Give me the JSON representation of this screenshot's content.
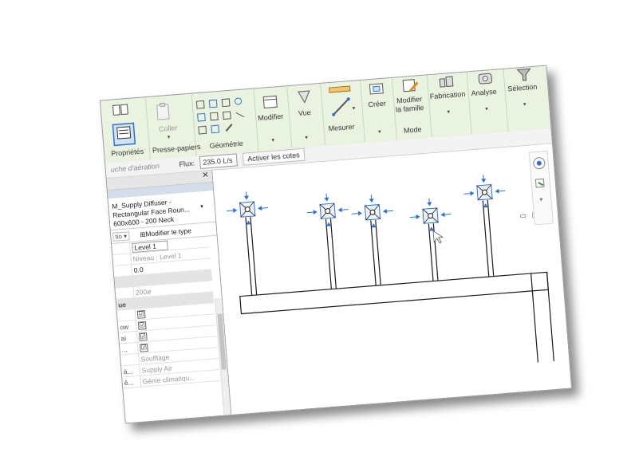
{
  "ribbon": {
    "proprietes_label": "Propriétés",
    "coller_label": "Coller",
    "presse_papiers_label": "Presse-papiers",
    "geometrie_label": "Géométrie",
    "modifier_label": "Modifier",
    "vue_label": "Vue",
    "mesurer_label": "Mesurer",
    "creer_label": "Créer",
    "modifier_famille_line1": "Modifier",
    "modifier_famille_line2": "la famille",
    "mode_label": "Mode",
    "fabrication_label": "Fabrication",
    "analyse_label": "Analyse",
    "selection_label": "Sélection"
  },
  "options_bar": {
    "context_label": "uche d'aération",
    "flux_label": "Flux:",
    "flux_value": "235.0 L/s",
    "activer_cotes_label": "Activer les cotes"
  },
  "properties": {
    "type_line1": "M_Supply Diffuser -",
    "type_line2": "Rectangular Face Roun...",
    "type_line3": "600x600 - 200 Neck",
    "filter_label": "tio",
    "edit_type_label": "Modifier le type",
    "rows": [
      {
        "key": "",
        "value": "Level 1",
        "style": "input"
      },
      {
        "key": "",
        "value": "Niveau : Level 1",
        "style": "gray"
      },
      {
        "key": "",
        "value": "0.0",
        "style": "plain"
      },
      {
        "key": "",
        "value": "",
        "style": "hdr"
      },
      {
        "key": "",
        "value": "200ø",
        "style": "gray"
      },
      {
        "key": "ue",
        "value": "",
        "style": "hdr"
      },
      {
        "key": "",
        "value": "☑",
        "style": "check"
      },
      {
        "key": "ow",
        "value": "☑",
        "style": "check"
      },
      {
        "key": "ai",
        "value": "☑",
        "style": "check"
      },
      {
        "key": "...",
        "value": "☑",
        "style": "check"
      },
      {
        "key": "",
        "value": "Soufflage",
        "style": "gray"
      },
      {
        "key": "ä...",
        "value": "Supply Air",
        "style": "gray"
      },
      {
        "key": "ê...",
        "value": "Génie climatiqu...",
        "style": "gray"
      }
    ]
  },
  "window_controls": "▭ ▢ ⊠",
  "colors": {
    "ribbon_bg": "#eaf3e0",
    "selection_blue": "#2f6fd6",
    "drawing_line": "#1a1a1a"
  }
}
